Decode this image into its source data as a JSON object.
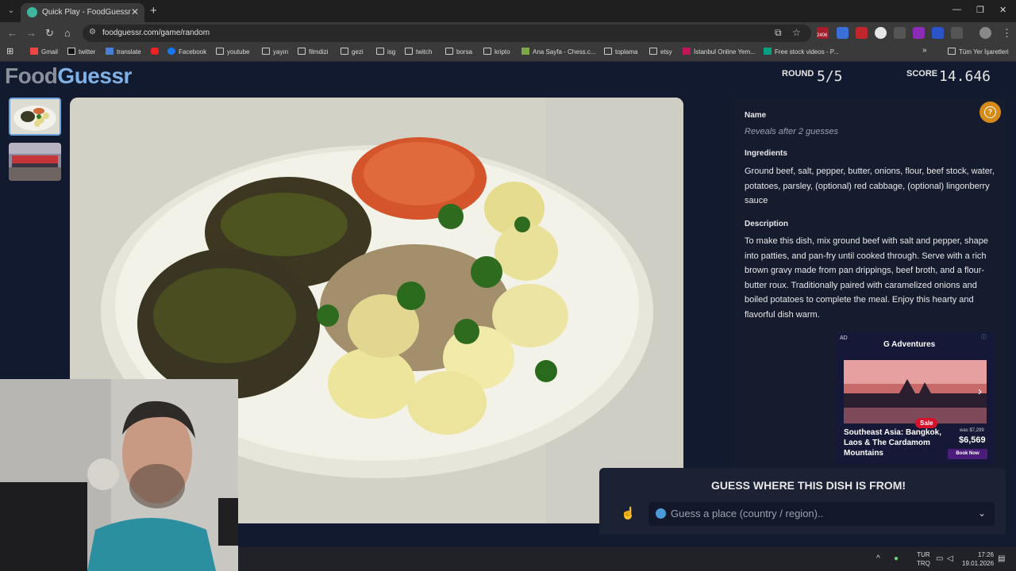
{
  "browser": {
    "tab_title": "Quick Play - FoodGuessr | Food",
    "url": "foodguessr.com/game/random",
    "bookmarks": [
      "Gmail",
      "twitter",
      "translate",
      "Facebook",
      "youtube",
      "yayın",
      "filmdizi",
      "gezi",
      "isg",
      "twitch",
      "borsa",
      "kripto",
      "Ana Sayfa - Chess.c...",
      "toplama",
      "etsy",
      "İstanbul Online Yem...",
      "Free stock videos - P..."
    ],
    "bookmarks_more": "»",
    "all_bookmarks": "Tüm Yer İşaretleri",
    "ext_badge": "2406"
  },
  "header": {
    "logo_food": "Food",
    "logo_guessr": "Guessr",
    "round_label": "ROUND",
    "round_value": "5/5",
    "score_label": "SCORE",
    "score_value": "14.646"
  },
  "info": {
    "name_label": "Name",
    "name_value": "Reveals after 2 guesses",
    "ingredients_label": "Ingredients",
    "ingredients": "Ground beef, salt, pepper, butter, onions, flour, beef stock, water, potatoes, parsley, (optional) red cabbage, (optional) lingonberry sauce",
    "description_label": "Description",
    "description": "To make this dish, mix ground beef with salt and pepper, shape into patties, and pan-fry until cooked through. Serve with a rich brown gravy made from pan drippings, beef broth, and a flour-butter roux. Traditionally paired with caramelized onions and boiled potatoes to complete the meal. Enjoy this hearty and flavorful dish warm."
  },
  "ad": {
    "tag": "AD",
    "brand": "G Adventures",
    "title": "Southeast Asia: Bangkok, Laos & The Cardamom Mountains",
    "sale": "Sale",
    "was": "was $7,299",
    "price": "$6,569",
    "cta": "Book Now"
  },
  "guess": {
    "title": "GUESS WHERE THIS DISH IS FROM!",
    "placeholder": "Guess a place (country / region).."
  },
  "taskbar": {
    "lang_top": "TUR",
    "lang_bottom": "TRQ",
    "time": "17:26",
    "date": "19.01.2026"
  },
  "colors": {
    "page_bg": "#111a2e",
    "accent_blue": "#7fb0e6",
    "help_orange": "#d68a17"
  }
}
